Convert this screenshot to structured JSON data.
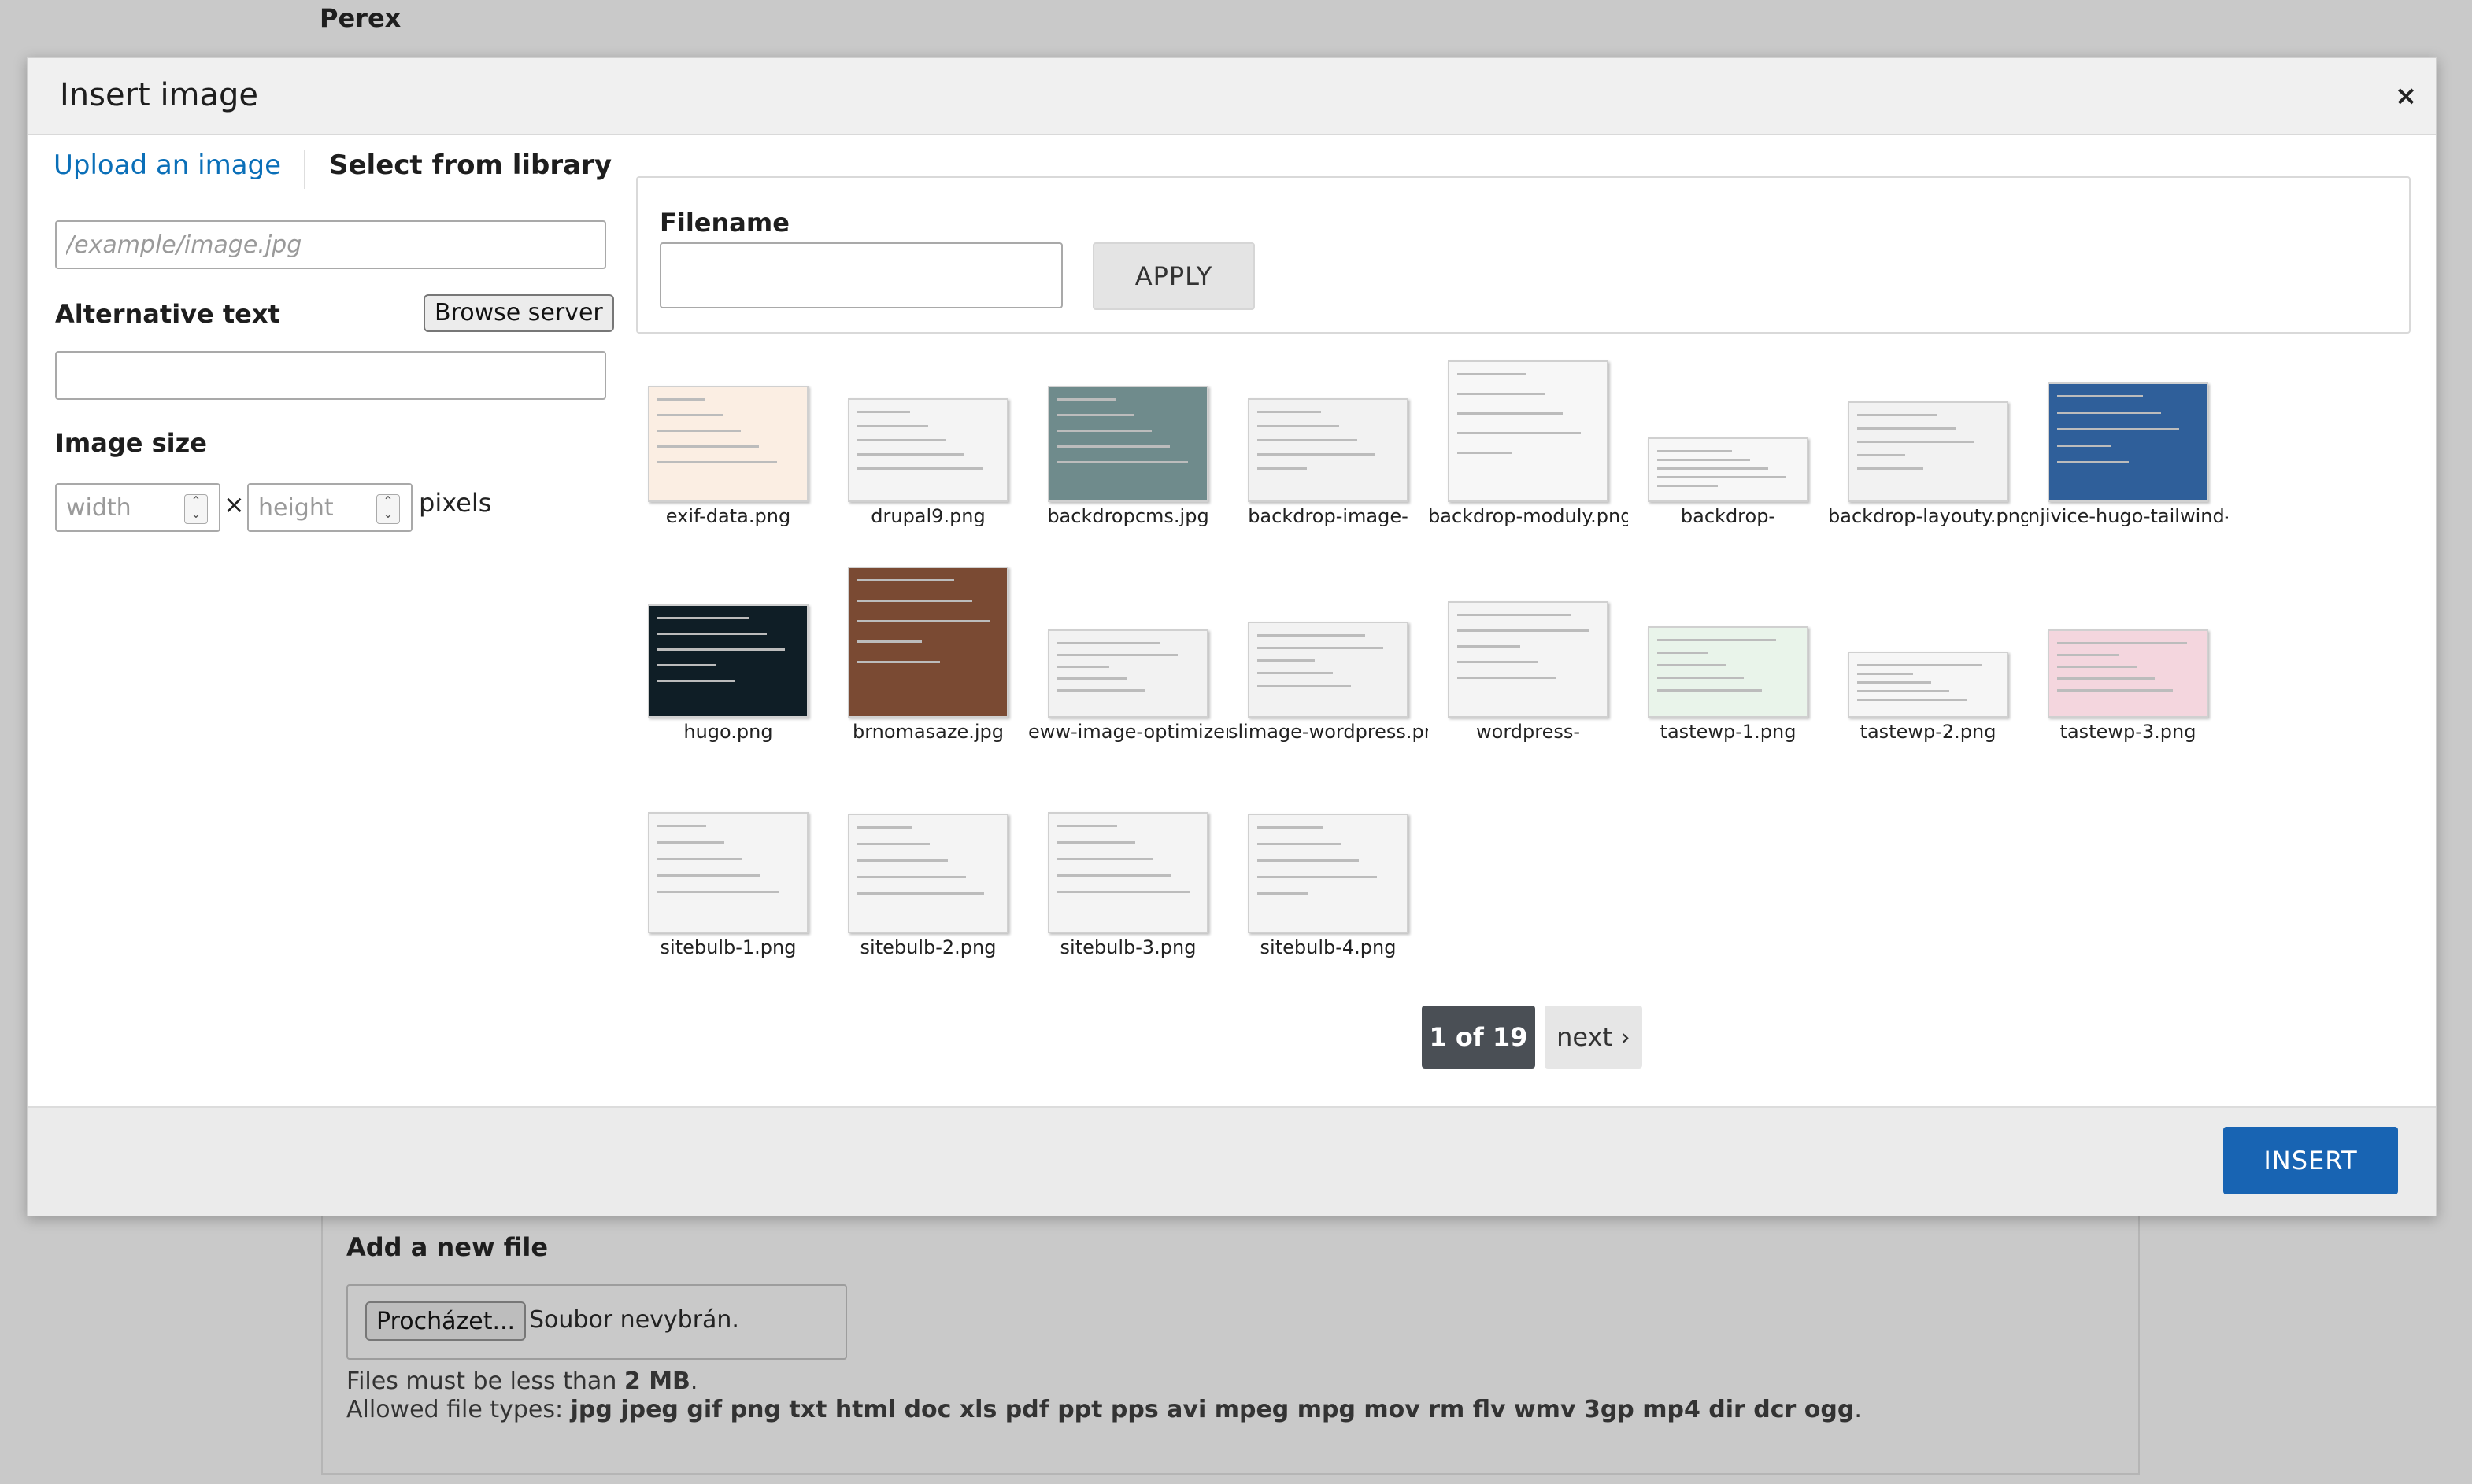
{
  "background": {
    "perex_label": "Perex",
    "add_file_title": "Add a new file",
    "file_browse_button": "Procházet...",
    "file_none_selected": "Soubor nevybrán.",
    "size_limit_prefix": "Files must be less than ",
    "size_limit_value": "2 MB",
    "size_limit_suffix": ".",
    "allowed_types_prefix": "Allowed file types: ",
    "allowed_types_value": "jpg jpeg gif png txt html doc xls pdf ppt pps avi mpeg mpg mov rm flv wmv 3gp mp4 dir dcr ogg",
    "allowed_types_suffix": "."
  },
  "modal": {
    "title": "Insert image",
    "close_symbol": "×",
    "tabs": {
      "upload": "Upload an image",
      "library": "Select from library"
    },
    "url_placeholder": "/example/image.jpg",
    "alt_label": "Alternative text",
    "browse_server": "Browse server",
    "image_size_label": "Image size",
    "width_placeholder": "width",
    "height_placeholder": "height",
    "times_symbol": "×",
    "pixels_label": "pixels",
    "filter": {
      "label": "Filename",
      "value": "",
      "apply": "APPLY"
    },
    "thumbnails": [
      {
        "caption": "exif-data.png",
        "tone": "#fbeee3"
      },
      {
        "caption": "drupal9.png",
        "tone": "#f4f4f4"
      },
      {
        "caption": "backdropcms.jpg",
        "tone": "#6f8b8c"
      },
      {
        "caption": "backdrop-image-",
        "tone": "#f2f2f2"
      },
      {
        "caption": "backdrop-moduly.png",
        "tone": "#f7f7f7"
      },
      {
        "caption": "backdrop-",
        "tone": "#f7f7f7"
      },
      {
        "caption": "backdrop-layouty.png",
        "tone": "#f2f2f2"
      },
      {
        "caption": "njivice-hugo-tailwind-",
        "tone": "#2f5f9a"
      },
      {
        "caption": "hugo.png",
        "tone": "#0f1e26"
      },
      {
        "caption": "brnomasaze.jpg",
        "tone": "#7a4a33"
      },
      {
        "caption": "eww-image-optimizer-",
        "tone": "#f2f2f2"
      },
      {
        "caption": "slimage-wordpress.png",
        "tone": "#f2f2f2"
      },
      {
        "caption": "wordpress-",
        "tone": "#f4f4f4"
      },
      {
        "caption": "tastewp-1.png",
        "tone": "#e9f4ea"
      },
      {
        "caption": "tastewp-2.png",
        "tone": "#f6f6f6"
      },
      {
        "caption": "tastewp-3.png",
        "tone": "#f4d6de"
      },
      {
        "caption": "sitebulb-1.png",
        "tone": "#f4f4f4"
      },
      {
        "caption": "sitebulb-2.png",
        "tone": "#f4f4f4"
      },
      {
        "caption": "sitebulb-3.png",
        "tone": "#f4f4f4"
      },
      {
        "caption": "sitebulb-4.png",
        "tone": "#f4f4f4"
      }
    ],
    "pager": {
      "current": "1 of 19",
      "next": "next ›"
    },
    "insert_button": "INSERT"
  },
  "colors": {
    "link_blue": "#0a6fb8",
    "primary_button": "#1864b3",
    "pager_current": "#4a4f55",
    "overlay": "#c9c9c9"
  }
}
